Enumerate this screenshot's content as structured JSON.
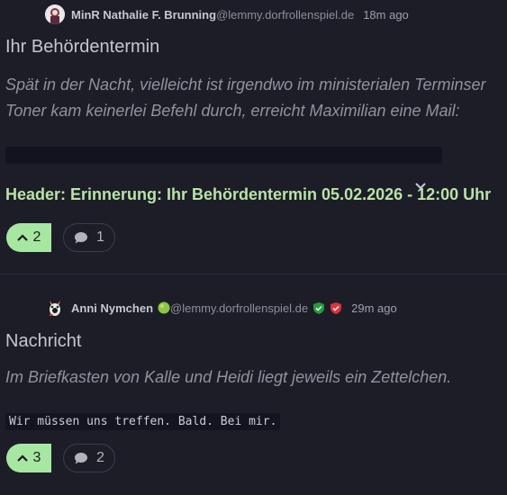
{
  "posts": [
    {
      "author": "MinR Nathalie F. Brunning",
      "instance": "@lemmy.dorfrollenspiel.de",
      "time": "18m ago",
      "title": "Ihr Behördentermin",
      "body_lines": [
        "Spät in der Nacht, vielleicht ist irgendwo im ministerialen Terminser",
        "Toner kam keinerlei Befehl durch, erreicht Maximilian eine Mail:"
      ],
      "header_line": "Header: Erinnerung: Ihr Behördentermin 05.02.2026 - 12:00 Uhr",
      "votes": "2",
      "comments": "1"
    },
    {
      "author": "Anni Nymchen",
      "instance": "@lemmy.dorfrollenspiel.de",
      "time": "29m ago",
      "title": "Nachricht",
      "body_lines": [
        "Im Briefkasten von Kalle und Heidi liegt jeweils ein Zettelchen."
      ],
      "code": "Wir müssen uns treffen. Bald. Bei mir.",
      "votes": "3",
      "comments": "2"
    }
  ],
  "colors": {
    "background": "#1d1d28",
    "upvote": "#a6e7a1",
    "header_green": "#b9e3a6",
    "status_green": "#8dc63f",
    "shield_green": "#1f9e3a",
    "shield_red": "#e0303a"
  },
  "icons": [
    "chevron-down-icon",
    "upvote-arrow-icon",
    "comment-bubble-icon",
    "shield-check-icon"
  ]
}
